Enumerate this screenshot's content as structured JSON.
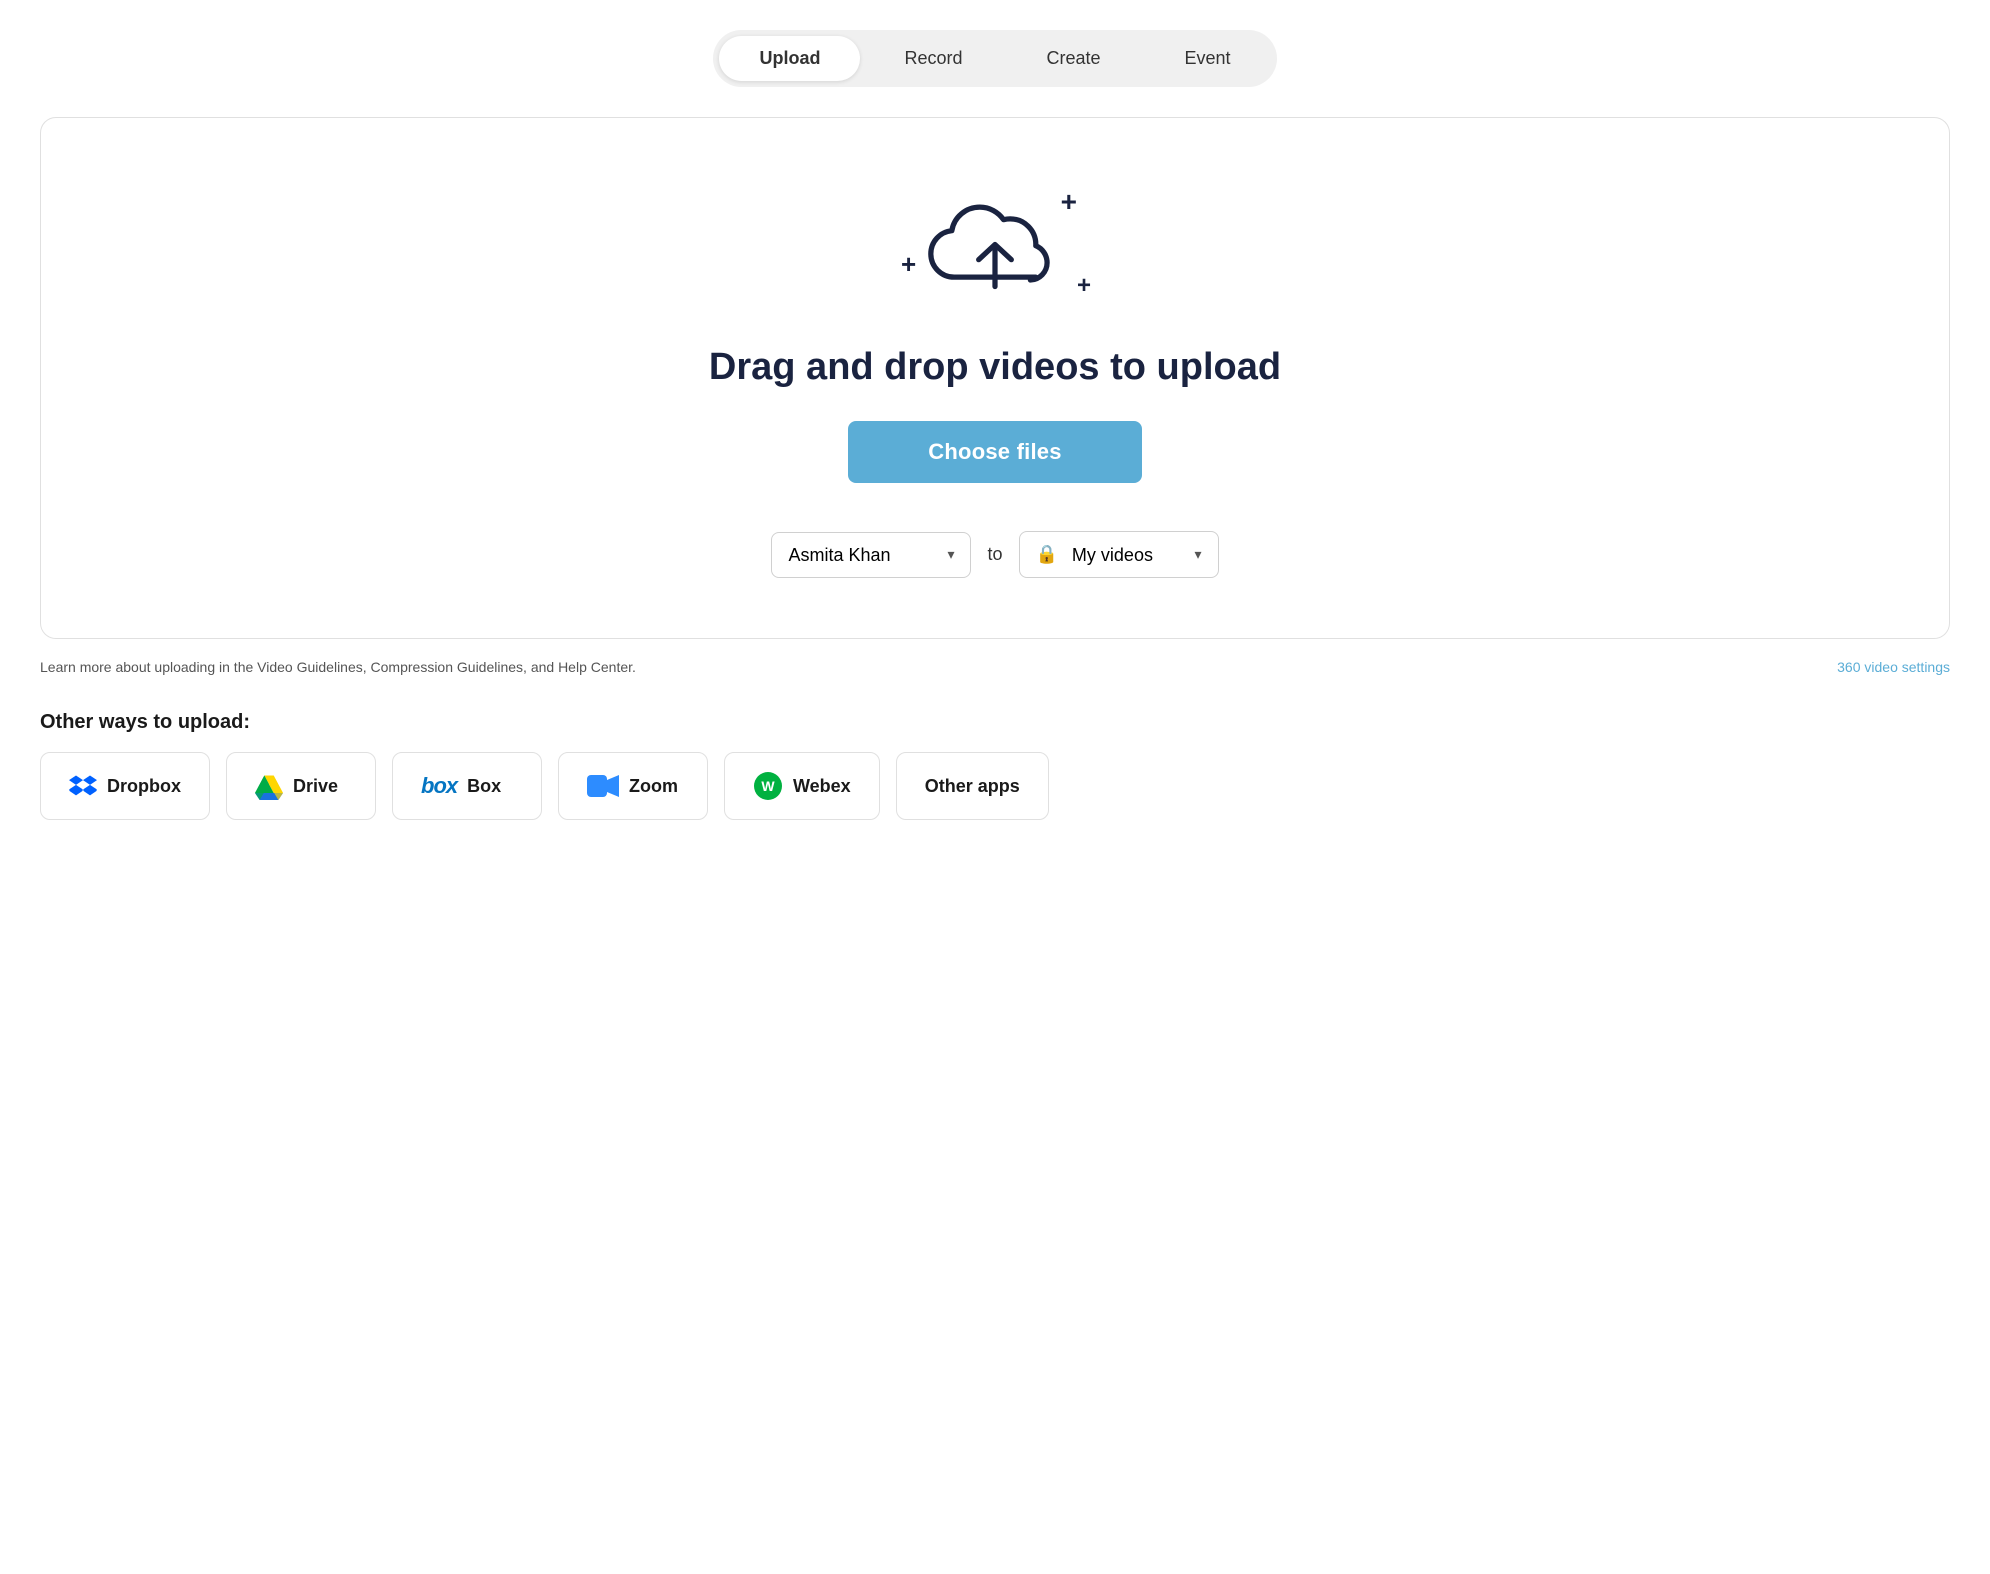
{
  "tabs": [
    {
      "id": "upload",
      "label": "Upload",
      "active": true
    },
    {
      "id": "record",
      "label": "Record",
      "active": false
    },
    {
      "id": "create",
      "label": "Create",
      "active": false
    },
    {
      "id": "event",
      "label": "Event",
      "active": false
    }
  ],
  "upload_area": {
    "drag_drop_text": "Drag and drop videos to upload",
    "choose_files_label": "Choose files",
    "to_label": "to",
    "user_select": {
      "value": "Asmita Khan",
      "options": [
        "Asmita Khan"
      ]
    },
    "destination_select": {
      "value": "My videos",
      "options": [
        "My videos"
      ]
    }
  },
  "info_bar": {
    "text": "Learn more about uploading in the Video Guidelines, Compression Guidelines, and Help Center.",
    "link_label": "360 video settings"
  },
  "other_ways": {
    "title": "Other ways to upload:",
    "options": [
      {
        "id": "dropbox",
        "label": "Dropbox"
      },
      {
        "id": "drive",
        "label": "Drive"
      },
      {
        "id": "box",
        "label": "Box"
      },
      {
        "id": "zoom",
        "label": "Zoom"
      },
      {
        "id": "webex",
        "label": "Webex"
      },
      {
        "id": "other-apps",
        "label": "Other apps"
      }
    ]
  }
}
